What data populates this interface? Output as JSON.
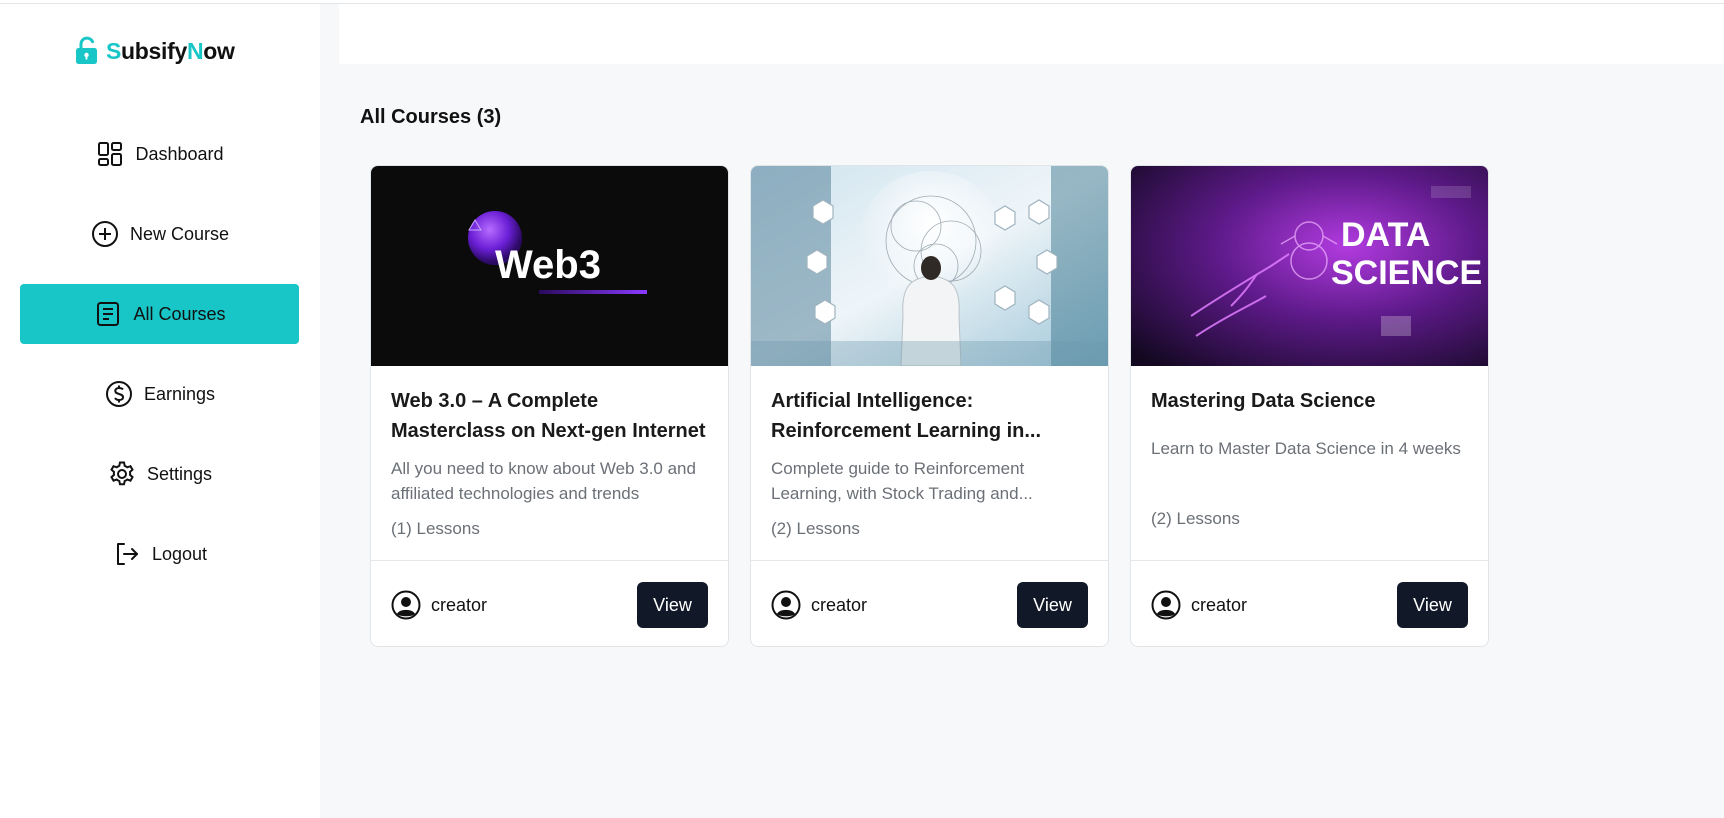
{
  "brand": {
    "part1": "S",
    "part2": "ubsify",
    "part3": "N",
    "part4": "ow",
    "accent": "#19c6c7"
  },
  "sidebar": {
    "items": [
      {
        "label": "Dashboard",
        "icon": "dashboard-icon",
        "active": false
      },
      {
        "label": "New Course",
        "icon": "plus-circle-icon",
        "active": false
      },
      {
        "label": "All Courses",
        "icon": "document-list-icon",
        "active": true
      },
      {
        "label": "Earnings",
        "icon": "dollar-circle-icon",
        "active": false
      },
      {
        "label": "Settings",
        "icon": "gear-icon",
        "active": false
      },
      {
        "label": "Logout",
        "icon": "logout-icon",
        "active": false
      }
    ]
  },
  "main": {
    "title": "All Courses (3)",
    "courses": [
      {
        "title": "Web 3.0 – A Complete Masterclass on Next-gen Internet",
        "description": "All you need to know about Web 3.0 and affiliated technologies and trends",
        "lessons": "(1) Lessons",
        "author": "creator",
        "button": "View",
        "thumb_text": "Web3"
      },
      {
        "title": "Artificial Intelligence: Reinforcement Learning in...",
        "description": "Complete guide to Reinforcement Learning, with Stock Trading and...",
        "lessons": "(2) Lessons",
        "author": "creator",
        "button": "View"
      },
      {
        "title": "Mastering Data Science",
        "description": "Learn to Master Data Science in 4 weeks",
        "lessons": "(2) Lessons",
        "author": "creator",
        "button": "View",
        "thumb_text_1": "DATA",
        "thumb_text_2": "SCIENCE"
      }
    ]
  }
}
